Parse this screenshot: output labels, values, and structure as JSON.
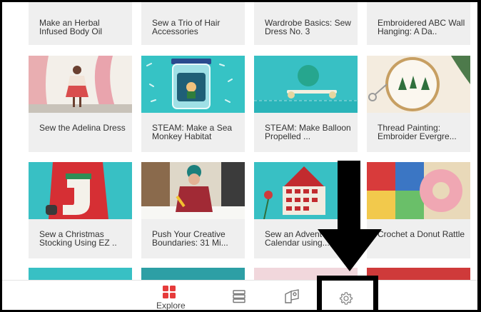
{
  "colors": {
    "accent": "#e63b3b",
    "arrow": "#000000"
  },
  "cards": [
    {
      "title": "Make an Herbal Infused Body Oil"
    },
    {
      "title": "Sew a Trio of Hair Accessories"
    },
    {
      "title": "Wardrobe Basics: Sew Dress No. 3"
    },
    {
      "title": "Embroidered ABC Wall Hanging: A Da.."
    },
    {
      "title": "Sew the Adelina Dress"
    },
    {
      "title": "STEAM: Make a Sea Monkey Habitat"
    },
    {
      "title": "STEAM: Make Balloon Propelled ..."
    },
    {
      "title": "Thread Painting: Embroider Evergre..."
    },
    {
      "title": "Sew a Christmas Stocking Using EZ .."
    },
    {
      "title": "Push Your Creative Boundaries: 31 Mi..."
    },
    {
      "title": "Sew an Advent Calendar using..."
    },
    {
      "title": "Crochet a Donut Rattle"
    }
  ],
  "nav": {
    "explore_label": "Explore",
    "items": [
      {
        "icon": "explore-grid-icon",
        "label": "Explore"
      },
      {
        "icon": "list-icon"
      },
      {
        "icon": "projects-icon"
      },
      {
        "icon": "gear-icon"
      }
    ]
  }
}
